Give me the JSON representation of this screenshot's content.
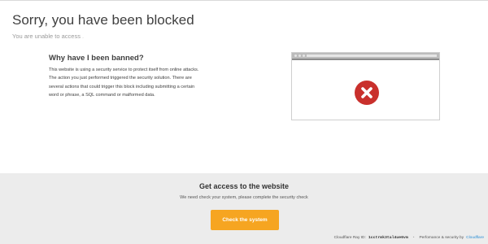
{
  "header": {
    "title": "Sorry, you have been blocked",
    "subtitle": "You are unable to access",
    "blocked_domain": "."
  },
  "explanation": {
    "heading": "Why have I been banned?",
    "body": "This website is using a security service to protect itself from online attacks. The action you just performed triggered the security solution. There are several actions that could trigger this block including submitting a certain word or phrase, a SQL command or malformed data."
  },
  "icons": {
    "browser": "browser-window-icon",
    "error": "error-x-circle-icon",
    "error_color": "#c9302c"
  },
  "access": {
    "heading": "Get access to the website",
    "text": "We need check your system, please complete the security check",
    "button_label": "Check the system",
    "button_color": "#f6a521"
  },
  "footer": {
    "ray_label": "Cloudflare Ray ID:",
    "ray_id": "1cctrmk3tal4ue6vm",
    "performance_text": "Perfomance & security by",
    "provider_link": "Cloudflare",
    "link_color": "#2d8fd5"
  }
}
